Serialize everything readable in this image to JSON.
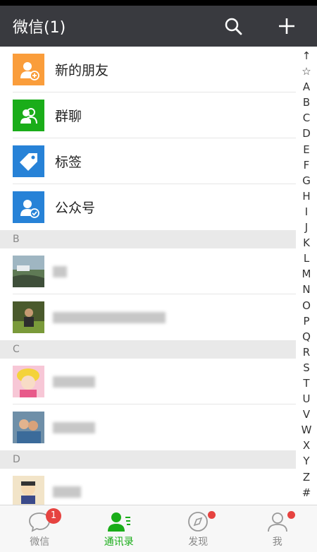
{
  "header": {
    "title": "微信(1)"
  },
  "fixed_items": [
    {
      "label": "新的朋友",
      "icon": "add-friend-icon",
      "color": "#fa9d3b"
    },
    {
      "label": "群聊",
      "icon": "group-chat-icon",
      "color": "#1aad19"
    },
    {
      "label": "标签",
      "icon": "tag-icon",
      "color": "#2782d7"
    },
    {
      "label": "公众号",
      "icon": "official-account-icon",
      "color": "#2782d7"
    }
  ],
  "sections": [
    {
      "letter": "B"
    },
    {
      "letter": "C"
    },
    {
      "letter": "D"
    }
  ],
  "index_letters": [
    "↑",
    "☆",
    "A",
    "B",
    "C",
    "D",
    "E",
    "F",
    "G",
    "H",
    "I",
    "J",
    "K",
    "L",
    "M",
    "N",
    "O",
    "P",
    "Q",
    "R",
    "S",
    "T",
    "U",
    "V",
    "W",
    "X",
    "Y",
    "Z",
    "#"
  ],
  "tabbar": {
    "tabs": [
      {
        "label": "微信",
        "badge": "1"
      },
      {
        "label": "通讯录"
      },
      {
        "label": "发现"
      },
      {
        "label": "我"
      }
    ],
    "active_color": "#1aad19"
  }
}
